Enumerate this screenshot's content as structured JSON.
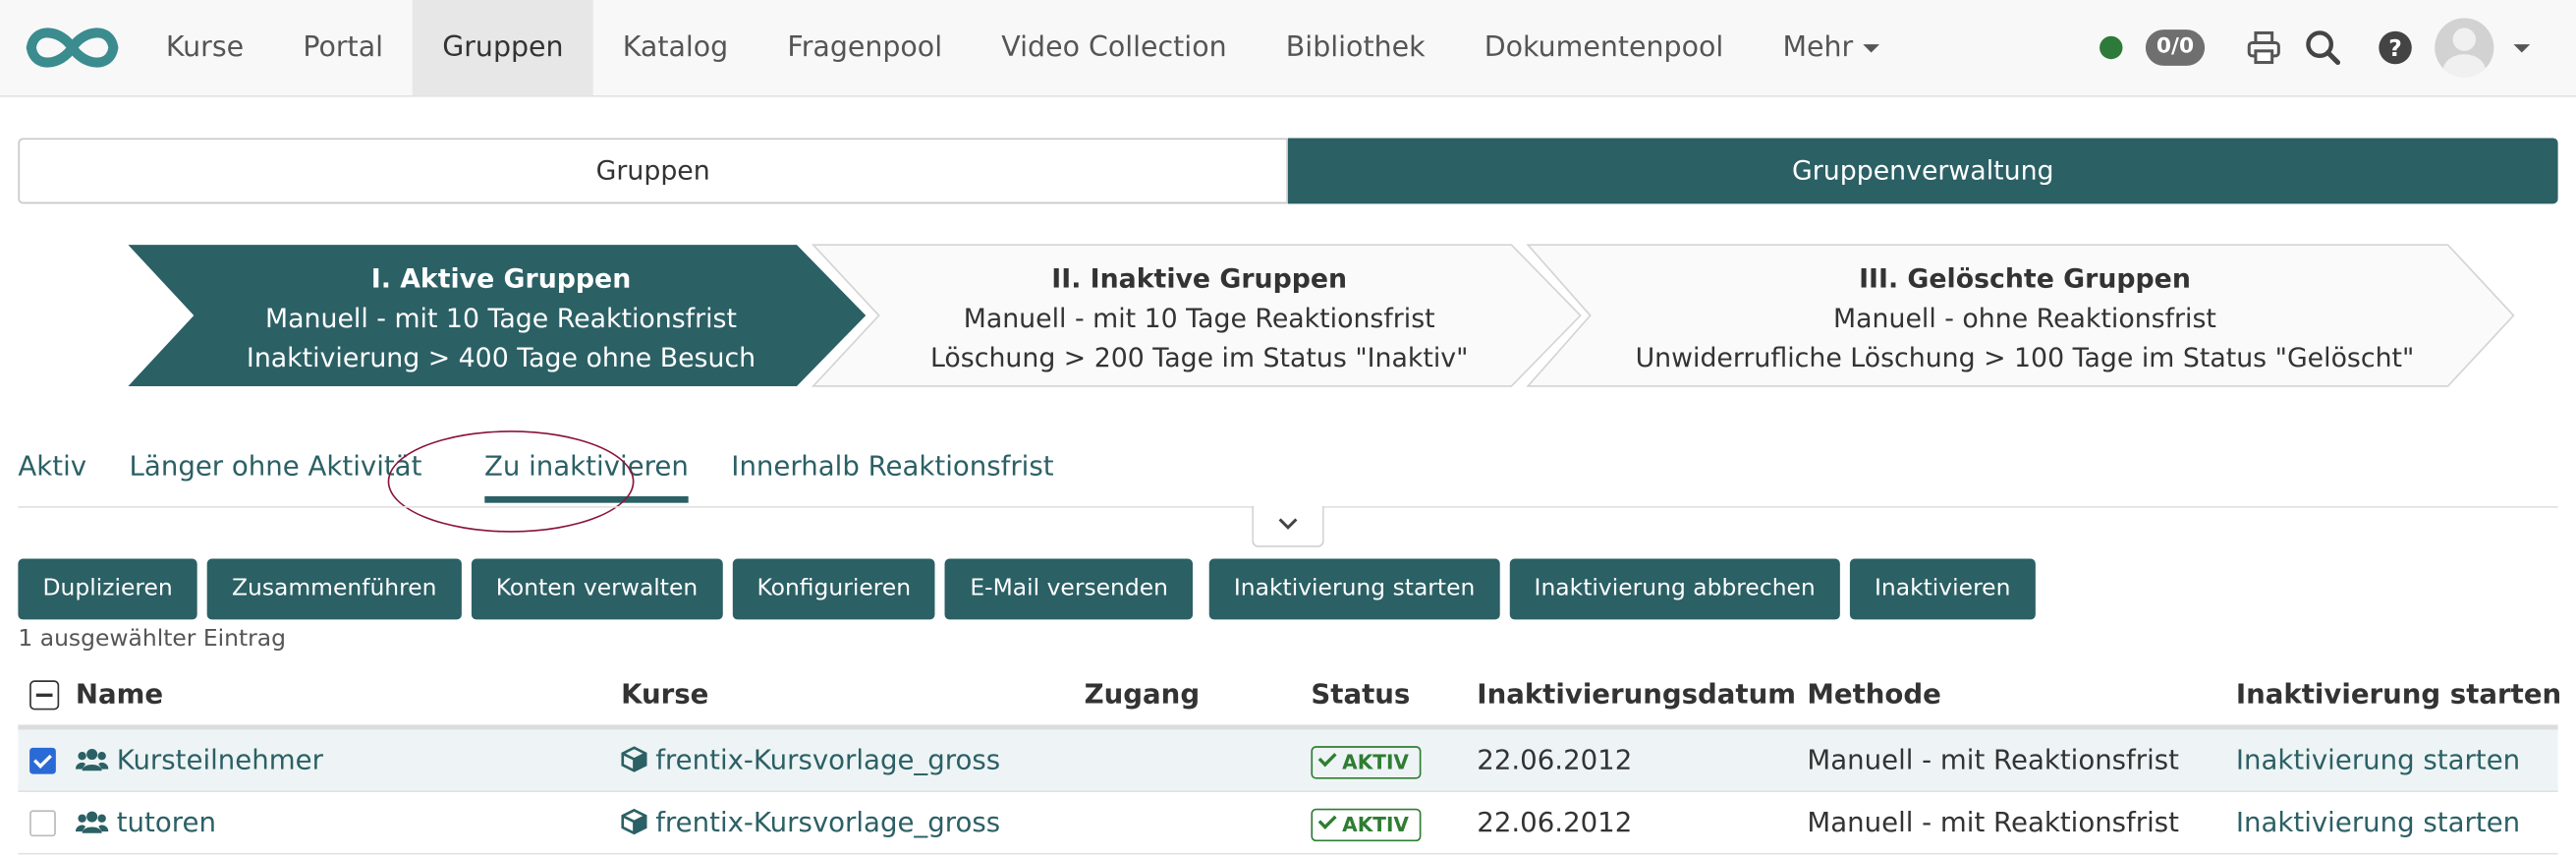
{
  "nav": {
    "items": [
      {
        "label": "Kurse"
      },
      {
        "label": "Portal"
      },
      {
        "label": "Gruppen",
        "active": true
      },
      {
        "label": "Katalog"
      },
      {
        "label": "Fragenpool"
      },
      {
        "label": "Video Collection"
      },
      {
        "label": "Bibliothek"
      },
      {
        "label": "Dokumentenpool"
      },
      {
        "label": "Mehr"
      }
    ],
    "badge": "0/0",
    "status_color": "#2d7a3a"
  },
  "segments": [
    {
      "label": "Gruppen"
    },
    {
      "label": "Gruppenverwaltung",
      "active": true
    }
  ],
  "steps": [
    {
      "title": "I. Aktive Gruppen",
      "line1": "Manuell - mit 10 Tage Reaktionsfrist",
      "line2": "Inaktivierung > 400 Tage ohne Besuch",
      "active": true
    },
    {
      "title": "II. Inaktive Gruppen",
      "line1": "Manuell - mit 10 Tage Reaktionsfrist",
      "line2": "Löschung > 200 Tage im Status \"Inaktiv\""
    },
    {
      "title": "III. Gelöschte Gruppen",
      "line1": "Manuell - ohne Reaktionsfrist",
      "line2": "Unwiderrufliche Löschung > 100 Tage im Status \"Gelöscht\""
    }
  ],
  "subtabs": [
    {
      "label": "Aktiv"
    },
    {
      "label": "Länger ohne Aktivität"
    },
    {
      "label": "Zu inaktivieren",
      "active": true
    },
    {
      "label": "Innerhalb Reaktionsfrist"
    }
  ],
  "actions": [
    "Duplizieren",
    "Zusammenführen",
    "Konten verwalten",
    "Konfigurieren",
    "E-Mail versenden",
    "Inaktivierung starten",
    "Inaktivierung abbrechen",
    "Inaktivieren"
  ],
  "selection_count": "1 ausgewählter Eintrag",
  "table": {
    "headers": [
      "Name",
      "Kurse",
      "Zugang",
      "Status",
      "Inaktivierungsdatum",
      "Methode",
      "Inaktivierung starten"
    ],
    "rows": [
      {
        "selected": true,
        "name": "Kursteilnehmer",
        "course": "frentix-Kursvorlage_gross",
        "access": "",
        "status": "AKTIV",
        "date": "22.06.2012",
        "method": "Manuell - mit Reaktionsfrist",
        "action": "Inaktivierung starten"
      },
      {
        "selected": false,
        "name": "tutoren",
        "course": "frentix-Kursvorlage_gross",
        "access": "",
        "status": "AKTIV",
        "date": "22.06.2012",
        "method": "Manuell - mit Reaktionsfrist",
        "action": "Inaktivierung starten"
      }
    ]
  },
  "colors": {
    "accent": "#2b6065",
    "status_green": "#2e7d32",
    "highlight_ellipse": "#8a1538"
  }
}
